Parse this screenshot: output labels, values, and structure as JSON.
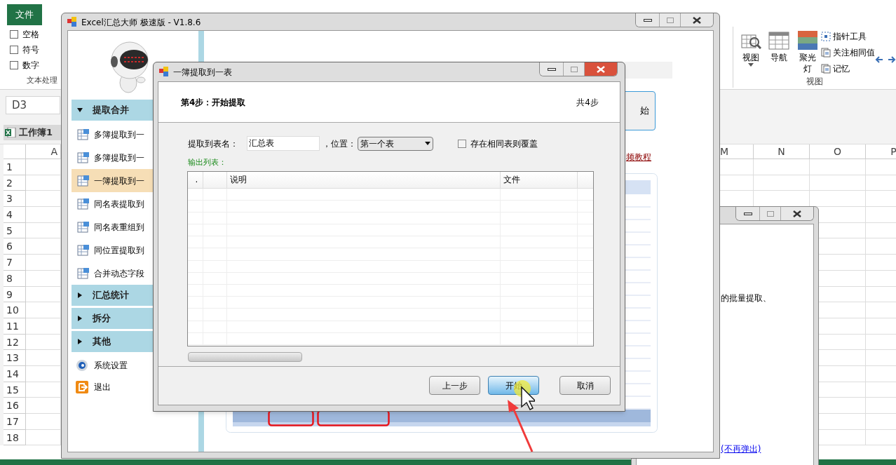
{
  "excel": {
    "file_tab": "文件",
    "ribbon_checkboxes": [
      {
        "label": "空格",
        "checked": false
      },
      {
        "label": "符号",
        "checked": false
      },
      {
        "label": "数字",
        "checked": false
      }
    ],
    "text_group_label": "文本处理",
    "view_group": {
      "label": "视图",
      "big_buttons": [
        {
          "kind": "view",
          "label": "视图"
        },
        {
          "kind": "nav",
          "label": "导航"
        },
        {
          "kind": "spot",
          "label": "聚光灯"
        }
      ],
      "small_buttons": [
        {
          "kind": "pointer",
          "label": "指针工具"
        },
        {
          "kind": "doc",
          "label": "关注相同值"
        },
        {
          "kind": "doc",
          "label": "记忆"
        }
      ]
    },
    "name_box": "D3",
    "workbook_tab": "工作簿1",
    "columns_left": [
      "A"
    ],
    "columns_right": [
      "M",
      "N",
      "O",
      "P"
    ],
    "rows": [
      "1",
      "2",
      "3",
      "4",
      "5",
      "6",
      "7",
      "8",
      "9",
      "10",
      "11",
      "12",
      "13",
      "14",
      "15",
      "16",
      "17",
      "18"
    ]
  },
  "main_window": {
    "title": "Excel汇总大师 极速版 - V1.8.6",
    "sidebar": [
      {
        "kind": "header",
        "label": "提取合并",
        "expanded": true
      },
      {
        "kind": "item",
        "label": "多簿提取到一",
        "selected": false
      },
      {
        "kind": "item",
        "label": "多簿提取到一",
        "selected": false
      },
      {
        "kind": "item",
        "label": "一簿提取到一",
        "selected": true
      },
      {
        "kind": "item",
        "label": "同名表提取到",
        "selected": false
      },
      {
        "kind": "item",
        "label": "同名表重组到",
        "selected": false
      },
      {
        "kind": "item",
        "label": "同位置提取到",
        "selected": false
      },
      {
        "kind": "item",
        "label": "合并动态字段",
        "selected": false
      },
      {
        "kind": "header",
        "label": "汇总统计",
        "expanded": false
      },
      {
        "kind": "header",
        "label": "拆分",
        "expanded": false
      },
      {
        "kind": "header",
        "label": "其他",
        "expanded": false
      },
      {
        "kind": "settings",
        "label": "系统设置"
      },
      {
        "kind": "exit",
        "label": "退出"
      }
    ],
    "start_button_fragment": "始",
    "tutorial_link": "频教程"
  },
  "notice_window": {
    "text": "的批量提取、",
    "link": "(不再弹出)"
  },
  "dialog": {
    "title": "一簿提取到一表",
    "step_title": "第4步：开始提取",
    "step_count": "共4步",
    "sheet_name_label": "提取到表名：",
    "sheet_name_value": "汇总表",
    "position_label": "，位置：",
    "position_value": "第一个表",
    "overwrite": {
      "label": "存在相同表则覆盖",
      "checked": false
    },
    "output_label": "输出列表：",
    "columns": [
      {
        "label": "."
      },
      {
        "label": "说明"
      },
      {
        "label": "文件"
      }
    ],
    "buttons": [
      {
        "label": "上一步",
        "hovered": false
      },
      {
        "label": "开始",
        "hovered": true
      },
      {
        "label": "取消",
        "hovered": false
      }
    ]
  }
}
